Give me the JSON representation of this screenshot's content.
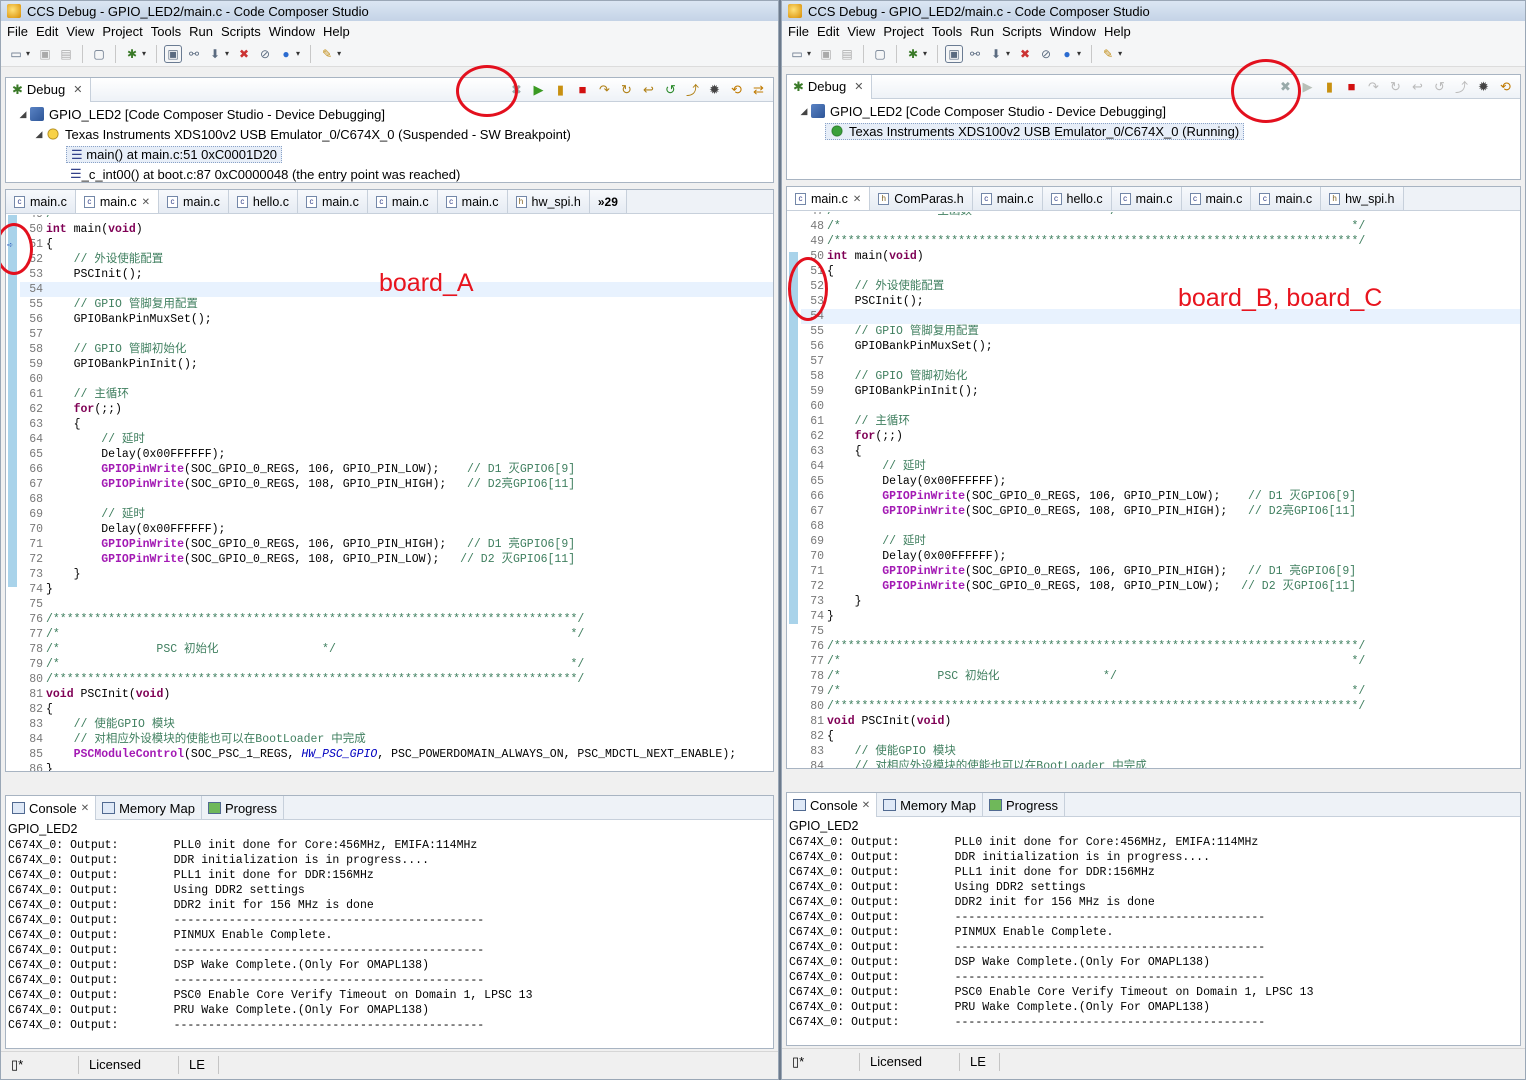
{
  "left": {
    "title": "CCS Debug - GPIO_LED2/main.c - Code Composer Studio",
    "menu": [
      "File",
      "Edit",
      "View",
      "Project",
      "Tools",
      "Run",
      "Scripts",
      "Window",
      "Help"
    ],
    "debug_tab": "Debug",
    "tree": [
      {
        "text": "GPIO_LED2 [Code Composer Studio - Device Debugging]"
      },
      {
        "text": "Texas Instruments XDS100v2 USB Emulator_0/C674X_0 (Suspended - SW Breakpoint)"
      },
      {
        "text": "main() at main.c:51 0xC0001D20"
      },
      {
        "text": "_c_int00() at boot.c:87 0xC0000048  (the entry point was reached)"
      }
    ],
    "editor_tabs": [
      "main.c",
      "main.c",
      "main.c",
      "hello.c",
      "main.c",
      "main.c",
      "main.c",
      "hw_spi.h",
      "»29"
    ],
    "annotation": "board_A",
    "code": [
      {
        "no": "49",
        "t": "/"
      },
      {
        "no": "50",
        "t": "int main(void)"
      },
      {
        "no": "51",
        "t": "{"
      },
      {
        "no": "52",
        "t": "    // 外设使能配置"
      },
      {
        "no": "53",
        "t": "    PSCInit();"
      },
      {
        "no": "54",
        "t": ""
      },
      {
        "no": "55",
        "t": "    // GPIO 管脚复用配置"
      },
      {
        "no": "56",
        "t": "    GPIOBankPinMuxSet();"
      },
      {
        "no": "57",
        "t": ""
      },
      {
        "no": "58",
        "t": "    // GPIO 管脚初始化"
      },
      {
        "no": "59",
        "t": "    GPIOBankPinInit();"
      },
      {
        "no": "60",
        "t": ""
      },
      {
        "no": "61",
        "t": "    // 主循环"
      },
      {
        "no": "62",
        "t": "    for(;;)"
      },
      {
        "no": "63",
        "t": "    {"
      },
      {
        "no": "64",
        "t": "        // 延时"
      },
      {
        "no": "65",
        "t": "        Delay(0x00FFFFFF);"
      },
      {
        "no": "66",
        "t": "        GPIOPinWrite(SOC_GPIO_0_REGS, 106, GPIO_PIN_LOW);    // D1 灭GPIO6[9]"
      },
      {
        "no": "67",
        "t": "        GPIOPinWrite(SOC_GPIO_0_REGS, 108, GPIO_PIN_HIGH);   // D2亮GPIO6[11]"
      },
      {
        "no": "68",
        "t": ""
      },
      {
        "no": "69",
        "t": "        // 延时"
      },
      {
        "no": "70",
        "t": "        Delay(0x00FFFFFF);"
      },
      {
        "no": "71",
        "t": "        GPIOPinWrite(SOC_GPIO_0_REGS, 106, GPIO_PIN_HIGH);   // D1 亮GPIO6[9]"
      },
      {
        "no": "72",
        "t": "        GPIOPinWrite(SOC_GPIO_0_REGS, 108, GPIO_PIN_LOW);   // D2 灭GPIO6[11]"
      },
      {
        "no": "73",
        "t": "    }"
      },
      {
        "no": "74",
        "t": "}"
      },
      {
        "no": "75",
        "t": ""
      },
      {
        "no": "76",
        "t": "/****************************************************************************/"
      },
      {
        "no": "77",
        "t": "/*                                                                          */"
      },
      {
        "no": "78",
        "t": "/*              PSC 初始化               */"
      },
      {
        "no": "79",
        "t": "/*                                                                          */"
      },
      {
        "no": "80",
        "t": "/****************************************************************************/"
      },
      {
        "no": "81",
        "t": "void PSCInit(void)"
      },
      {
        "no": "82",
        "t": "{"
      },
      {
        "no": "83",
        "t": "    // 使能GPIO 模块"
      },
      {
        "no": "84",
        "t": "    // 对相应外设模块的使能也可以在BootLoader 中完成"
      },
      {
        "no": "85",
        "t": "    PSCModuleControl(SOC_PSC_1_REGS, HW_PSC_GPIO, PSC_POWERDOMAIN_ALWAYS_ON, PSC_MDCTL_NEXT_ENABLE);"
      },
      {
        "no": "86",
        "t": "}"
      }
    ],
    "console_tabs": [
      "Console",
      "Memory Map",
      "Progress"
    ],
    "console_name": "GPIO_LED2",
    "console_lines": [
      "C674X_0: Output:        PLL0 init done for Core:456MHz, EMIFA:114MHz",
      "C674X_0: Output:        DDR initialization is in progress....",
      "C674X_0: Output:        PLL1 init done for DDR:156MHz",
      "C674X_0: Output:        Using DDR2 settings",
      "C674X_0: Output:        DDR2 init for 156 MHz is done",
      "C674X_0: Output:        ---------------------------------------------",
      "C674X_0: Output:        PINMUX Enable Complete.",
      "C674X_0: Output:        ---------------------------------------------",
      "C674X_0: Output:        DSP Wake Complete.(Only For OMAPL138)",
      "C674X_0: Output:        ---------------------------------------------",
      "C674X_0: Output:        PSC0 Enable Core Verify Timeout on Domain 1, LPSC 13",
      "C674X_0: Output:        PRU Wake Complete.(Only For OMAPL138)",
      "C674X_0: Output:        ---------------------------------------------"
    ],
    "status": [
      "Licensed",
      "LE"
    ]
  },
  "right": {
    "title": "CCS Debug - GPIO_LED2/main.c - Code Composer Studio",
    "menu": [
      "File",
      "Edit",
      "View",
      "Project",
      "Tools",
      "Run",
      "Scripts",
      "Window",
      "Help"
    ],
    "debug_tab": "Debug",
    "tree": [
      {
        "text": "GPIO_LED2 [Code Composer Studio - Device Debugging]"
      },
      {
        "text": "Texas Instruments XDS100v2 USB Emulator_0/C674X_0 (Running)"
      }
    ],
    "editor_tabs": [
      "main.c",
      "ComParas.h",
      "main.c",
      "hello.c",
      "main.c",
      "main.c",
      "main.c",
      "hw_spi.h"
    ],
    "annotation": "board_B, board_C",
    "code": [
      {
        "no": "47",
        "t": "/*              主函数                   */"
      },
      {
        "no": "48",
        "t": "/*                                                                          */"
      },
      {
        "no": "49",
        "t": "/****************************************************************************/"
      },
      {
        "no": "50",
        "t": "int main(void)"
      },
      {
        "no": "51",
        "t": "{"
      },
      {
        "no": "52",
        "t": "    // 外设使能配置"
      },
      {
        "no": "53",
        "t": "    PSCInit();"
      },
      {
        "no": "54",
        "t": ""
      },
      {
        "no": "55",
        "t": "    // GPIO 管脚复用配置"
      },
      {
        "no": "56",
        "t": "    GPIOBankPinMuxSet();"
      },
      {
        "no": "57",
        "t": ""
      },
      {
        "no": "58",
        "t": "    // GPIO 管脚初始化"
      },
      {
        "no": "59",
        "t": "    GPIOBankPinInit();"
      },
      {
        "no": "60",
        "t": ""
      },
      {
        "no": "61",
        "t": "    // 主循环"
      },
      {
        "no": "62",
        "t": "    for(;;)"
      },
      {
        "no": "63",
        "t": "    {"
      },
      {
        "no": "64",
        "t": "        // 延时"
      },
      {
        "no": "65",
        "t": "        Delay(0x00FFFFFF);"
      },
      {
        "no": "66",
        "t": "        GPIOPinWrite(SOC_GPIO_0_REGS, 106, GPIO_PIN_LOW);    // D1 灭GPIO6[9]"
      },
      {
        "no": "67",
        "t": "        GPIOPinWrite(SOC_GPIO_0_REGS, 108, GPIO_PIN_HIGH);   // D2亮GPIO6[11]"
      },
      {
        "no": "68",
        "t": ""
      },
      {
        "no": "69",
        "t": "        // 延时"
      },
      {
        "no": "70",
        "t": "        Delay(0x00FFFFFF);"
      },
      {
        "no": "71",
        "t": "        GPIOPinWrite(SOC_GPIO_0_REGS, 106, GPIO_PIN_HIGH);   // D1 亮GPIO6[9]"
      },
      {
        "no": "72",
        "t": "        GPIOPinWrite(SOC_GPIO_0_REGS, 108, GPIO_PIN_LOW);   // D2 灭GPIO6[11]"
      },
      {
        "no": "73",
        "t": "    }"
      },
      {
        "no": "74",
        "t": "}"
      },
      {
        "no": "75",
        "t": ""
      },
      {
        "no": "76",
        "t": "/****************************************************************************/"
      },
      {
        "no": "77",
        "t": "/*                                                                          */"
      },
      {
        "no": "78",
        "t": "/*              PSC 初始化               */"
      },
      {
        "no": "79",
        "t": "/*                                                                          */"
      },
      {
        "no": "80",
        "t": "/****************************************************************************/"
      },
      {
        "no": "81",
        "t": "void PSCInit(void)"
      },
      {
        "no": "82",
        "t": "{"
      },
      {
        "no": "83",
        "t": "    // 使能GPIO 模块"
      },
      {
        "no": "84",
        "t": "    // 对相应外设模块的使能也可以在BootLoader 中完成"
      }
    ],
    "console_tabs": [
      "Console",
      "Memory Map",
      "Progress"
    ],
    "console_name": "GPIO_LED2",
    "console_lines": [
      "C674X_0: Output:        PLL0 init done for Core:456MHz, EMIFA:114MHz",
      "C674X_0: Output:        DDR initialization is in progress....",
      "C674X_0: Output:        PLL1 init done for DDR:156MHz",
      "C674X_0: Output:        Using DDR2 settings",
      "C674X_0: Output:        DDR2 init for 156 MHz is done",
      "C674X_0: Output:        ---------------------------------------------",
      "C674X_0: Output:        PINMUX Enable Complete.",
      "C674X_0: Output:        ---------------------------------------------",
      "C674X_0: Output:        DSP Wake Complete.(Only For OMAPL138)",
      "C674X_0: Output:        ---------------------------------------------",
      "C674X_0: Output:        PSC0 Enable Core Verify Timeout on Domain 1, LPSC 13",
      "C674X_0: Output:        PRU Wake Complete.(Only For OMAPL138)",
      "C674X_0: Output:        ---------------------------------------------"
    ],
    "status": [
      "Licensed",
      "LE"
    ]
  },
  "colors": {
    "annotation": "#e8141e",
    "keyword": "#7f0055",
    "function": "#a31ab4",
    "comment": "#3f7f5f",
    "current_line": "#e8f2fe"
  }
}
